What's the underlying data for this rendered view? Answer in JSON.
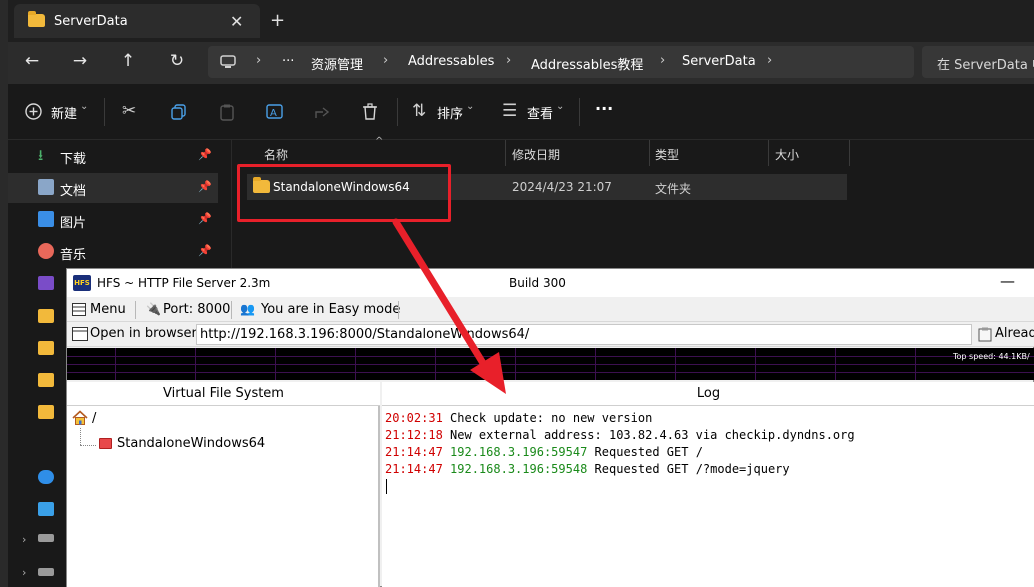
{
  "explorer": {
    "tab_title": "ServerData",
    "tab_close": "✕",
    "new_tab": "+",
    "nav": {
      "back": "←",
      "forward": "→",
      "up": "↑",
      "refresh": "↻"
    },
    "breadcrumb": [
      "资源管理",
      "Addressables",
      "Addressables教程",
      "ServerData"
    ],
    "breadcrumb_more": "···",
    "search_placeholder": "在 ServerData 中",
    "toolbar": {
      "new_label": "新建",
      "sort_label": "排序",
      "view_label": "查看",
      "more": "···"
    },
    "sidebar": [
      {
        "label": "下载",
        "icon": "download-icon",
        "color": "#4cb26b"
      },
      {
        "label": "文档",
        "icon": "document-icon",
        "color": "#8aa6c8"
      },
      {
        "label": "图片",
        "icon": "pictures-icon",
        "color": "#3a8ee6"
      },
      {
        "label": "音乐",
        "icon": "music-icon",
        "color": "#e8685a"
      }
    ],
    "columns": [
      "名称",
      "修改日期",
      "类型",
      "大小"
    ],
    "rows": [
      {
        "name": "StandaloneWindows64",
        "date": "2024/4/23 21:07",
        "type": "文件夹",
        "size": ""
      }
    ]
  },
  "hfs": {
    "title": "HFS ~ HTTP File Server 2.3m",
    "build": "Build 300",
    "logo": "HFS",
    "minimize": "—",
    "menu": {
      "menu_label": "Menu",
      "port_label": "Port: 8000",
      "mode_label": "You are in Easy mode"
    },
    "open_browser_label": "Open in browser",
    "url": "http://192.168.3.196:8000/StandaloneWindows64/",
    "already_label": "Already",
    "top_speed": "Top speed: 44.1KB/",
    "vfs_header": "Virtual File System",
    "vfs_root": "/",
    "vfs_child": "StandaloneWindows64",
    "log_header": "Log",
    "log": [
      {
        "time": "20:02:31",
        "addr": "",
        "msg": "Check update: no new version"
      },
      {
        "time": "21:12:18",
        "addr": "",
        "msg": "New external address: 103.82.4.63 via checkip.dyndns.org"
      },
      {
        "time": "21:14:47",
        "addr": "192.168.3.196:59547",
        "msg": "Requested GET /"
      },
      {
        "time": "21:14:47",
        "addr": "192.168.3.196:59548",
        "msg": "Requested GET /?mode=jquery"
      }
    ]
  },
  "colors": {
    "annotation": "#e8202a",
    "accent_folder": "#f2b93b",
    "log_time": "#d00000",
    "log_addr": "#1a8a1a"
  }
}
